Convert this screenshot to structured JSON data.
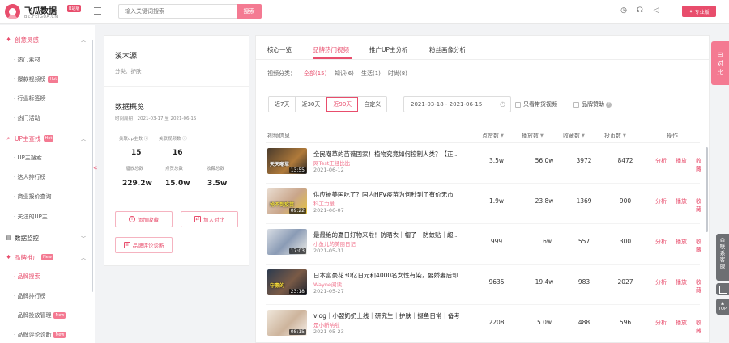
{
  "header": {
    "logo_title": "飞瓜数据",
    "logo_badge": "B站版",
    "logo_sub": "BZ.FEIGUA.CN",
    "search_placeholder": "输入关键词搜索",
    "search_label": "搜索",
    "pro_label": "专业版"
  },
  "sidebar": {
    "groups": [
      {
        "label": "创意灵感",
        "icon": "fire-icon"
      },
      {
        "label": "UP主查找",
        "icon": "search-icon",
        "tag": "Hot"
      },
      {
        "label": "数据监控",
        "icon": "monitor-icon"
      },
      {
        "label": "品牌推广",
        "icon": "diamond-icon",
        "tag": "New"
      }
    ],
    "items": [
      {
        "label": "热门素材"
      },
      {
        "label": "爆款视频榜",
        "tag": "Hot"
      },
      {
        "label": "行业标签榜"
      },
      {
        "label": "热门活动"
      },
      {
        "label": "UP主搜索"
      },
      {
        "label": "达人排行榜"
      },
      {
        "label": "商业报价查询"
      },
      {
        "label": "关注的UP主"
      },
      {
        "label": "品牌搜索"
      },
      {
        "label": "品牌排行榜"
      },
      {
        "label": "品牌投放管理",
        "tag": "New"
      },
      {
        "label": "品牌评论诊断",
        "tag": "New"
      }
    ]
  },
  "brand": {
    "name": "溪木源",
    "category": "分类：护肤",
    "overview_title": "数据概览",
    "overview_range": "时间周期：2021-03-17 至 2021-06-15",
    "stats": [
      {
        "label": "关联up主数",
        "value": "15"
      },
      {
        "label": "关联视频数",
        "value": "16"
      },
      {
        "label": "播放总数",
        "value": "229.2w"
      },
      {
        "label": "点赞总数",
        "value": "15.0w"
      },
      {
        "label": "收藏总数",
        "value": "3.5w"
      }
    ],
    "btn_favorite": "添加收藏",
    "btn_compare": "加入对比",
    "btn_diagnose": "品牌评论诊断"
  },
  "tabs": [
    "核心一览",
    "品牌热门视频",
    "推广UP主分析",
    "粉丝画像分析"
  ],
  "category": {
    "label": "视频分类：",
    "options": [
      "全部(15)",
      "知识(6)",
      "生活(1)",
      "时尚(8)"
    ]
  },
  "range_buttons": [
    "近7天",
    "近30天",
    "近90天",
    "自定义"
  ],
  "date_range": "2021-03-18 - 2021-06-15",
  "checkboxes": [
    "只看带货视频",
    "品牌赞助"
  ],
  "columns": [
    "视频信息",
    "点赞数",
    "播放数",
    "收藏数",
    "投币数",
    "操作"
  ],
  "actions": [
    "分析",
    "播放",
    "收藏"
  ],
  "rows": [
    {
      "title": "全民嘲草的苗薇国家！植物究竟如何控制人类？【正...",
      "author": "网Test正经比比",
      "date": "2021-06-12",
      "likes": "3.5w",
      "plays": "56.0w",
      "favs": "3972",
      "coins": "8472",
      "duration": "13:55",
      "caption": "天天嘲草"
    },
    {
      "title": "供应被美国吃了？国内HPV疫苗为何秒到了有价无市",
      "author": "科工力量",
      "date": "2021-06-07",
      "likes": "1.9w",
      "plays": "23.8w",
      "favs": "1369",
      "coins": "900",
      "duration": "09:22",
      "caption": "抢不到疫苗"
    },
    {
      "title": "最最绝的夏日好物来啦！防晒衣｜帽子｜防蚊贴｜超...",
      "author": "小鱼儿的美丽日记",
      "date": "2021-05-31",
      "likes": "999",
      "plays": "1.6w",
      "favs": "557",
      "coins": "300",
      "duration": "17:03",
      "caption": ""
    },
    {
      "title": "日本富豪花30亿日元和4000名女性有染，娶娇妻后却...",
      "author": "Wayne阅读",
      "date": "2021-05-27",
      "likes": "9635",
      "plays": "19.4w",
      "favs": "983",
      "coins": "2027",
      "duration": "23:18",
      "caption": "守寡的"
    },
    {
      "title": "vlog｜小盟奶奶上线｜研究生｜护肤｜摄鱼日常｜备考｜...",
      "author": "是小新呐啦",
      "date": "2021-05-23",
      "likes": "2208",
      "plays": "5.0w",
      "favs": "488",
      "coins": "596",
      "duration": "08:15",
      "caption": ""
    }
  ],
  "float": {
    "compare": [
      "对",
      "比"
    ],
    "contact": [
      "联",
      "系",
      "客",
      "服"
    ],
    "top": "TOP"
  }
}
